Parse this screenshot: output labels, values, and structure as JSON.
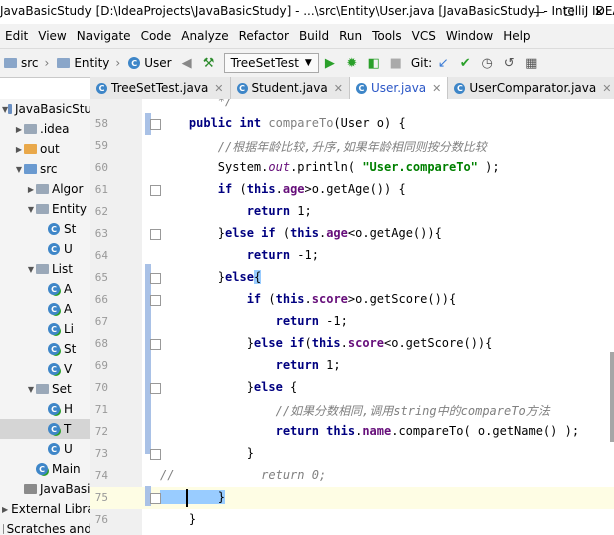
{
  "titlebar": {
    "title": "JavaBasicStudy [D:\\IdeaProjects\\JavaBasicStudy] - ...\\src\\Entity\\User.java [JavaBasicStudy] - IntelliJ IDEA (..."
  },
  "menu": [
    "Edit",
    "View",
    "Navigate",
    "Code",
    "Analyze",
    "Refactor",
    "Build",
    "Run",
    "Tools",
    "VCS",
    "Window",
    "Help"
  ],
  "nav": {
    "crumbs": [
      "src",
      "Entity",
      "User"
    ],
    "run_config": "TreeSetTest",
    "git_label": "Git:"
  },
  "tabs": [
    {
      "label": "TreeSetTest.java",
      "active": false
    },
    {
      "label": "Student.java",
      "active": false
    },
    {
      "label": "User.java",
      "active": true
    },
    {
      "label": "UserComparator.java",
      "active": false
    }
  ],
  "project_tree": [
    {
      "label": "JavaBasicStu",
      "indent": 0,
      "arrow": "down",
      "icon": "module"
    },
    {
      "label": ".idea",
      "indent": 1,
      "arrow": "right",
      "icon": "folder"
    },
    {
      "label": "out",
      "indent": 1,
      "arrow": "right",
      "icon": "folder-orange"
    },
    {
      "label": "src",
      "indent": 1,
      "arrow": "down",
      "icon": "folder-blue"
    },
    {
      "label": "Algor",
      "indent": 2,
      "arrow": "right",
      "icon": "package"
    },
    {
      "label": "Entity",
      "indent": 2,
      "arrow": "down",
      "icon": "package"
    },
    {
      "label": "St",
      "indent": 3,
      "arrow": "",
      "icon": "class"
    },
    {
      "label": "U",
      "indent": 3,
      "arrow": "",
      "icon": "class"
    },
    {
      "label": "List",
      "indent": 2,
      "arrow": "down",
      "icon": "package"
    },
    {
      "label": "A",
      "indent": 3,
      "arrow": "",
      "icon": "class-run"
    },
    {
      "label": "A",
      "indent": 3,
      "arrow": "",
      "icon": "class-run"
    },
    {
      "label": "Li",
      "indent": 3,
      "arrow": "",
      "icon": "class-run"
    },
    {
      "label": "St",
      "indent": 3,
      "arrow": "",
      "icon": "class-run"
    },
    {
      "label": "V",
      "indent": 3,
      "arrow": "",
      "icon": "class-run"
    },
    {
      "label": "Set",
      "indent": 2,
      "arrow": "down",
      "icon": "package"
    },
    {
      "label": "H",
      "indent": 3,
      "arrow": "",
      "icon": "class-run"
    },
    {
      "label": "T",
      "indent": 3,
      "arrow": "",
      "icon": "class-run",
      "selected": true
    },
    {
      "label": "U",
      "indent": 3,
      "arrow": "",
      "icon": "class"
    },
    {
      "label": "Main",
      "indent": 2,
      "arrow": "",
      "icon": "class-run"
    },
    {
      "label": "JavaBasic",
      "indent": 1,
      "arrow": "",
      "icon": "file"
    },
    {
      "label": "External Libra",
      "indent": 0,
      "arrow": "right",
      "icon": "library"
    },
    {
      "label": "Scratches and",
      "indent": 0,
      "arrow": "",
      "icon": "scratch"
    }
  ],
  "code_lines": [
    {
      "n": "",
      "parts": [
        {
          "t": "        */",
          "c": "cmt"
        }
      ]
    },
    {
      "n": "58",
      "parts": [
        {
          "t": "    ",
          "c": ""
        },
        {
          "t": "public int ",
          "c": "kw"
        },
        {
          "t": "compareTo",
          "c": "mth"
        },
        {
          "t": "(User o) {",
          "c": ""
        }
      ]
    },
    {
      "n": "59",
      "parts": [
        {
          "t": "        //根据年龄比较,升序,如果年龄相同则按分数比较",
          "c": "cmt"
        }
      ]
    },
    {
      "n": "60",
      "parts": [
        {
          "t": "        System.",
          "c": ""
        },
        {
          "t": "out",
          "c": "stat"
        },
        {
          "t": ".println( ",
          "c": ""
        },
        {
          "t": "\"User.compareTo\"",
          "c": "str"
        },
        {
          "t": " );",
          "c": ""
        }
      ]
    },
    {
      "n": "61",
      "parts": [
        {
          "t": "        ",
          "c": ""
        },
        {
          "t": "if ",
          "c": "kw"
        },
        {
          "t": "(",
          "c": ""
        },
        {
          "t": "this",
          "c": "kw"
        },
        {
          "t": ".",
          "c": ""
        },
        {
          "t": "age",
          "c": "fld"
        },
        {
          "t": ">o.getAge()) {",
          "c": ""
        }
      ]
    },
    {
      "n": "62",
      "parts": [
        {
          "t": "            ",
          "c": ""
        },
        {
          "t": "return ",
          "c": "kw"
        },
        {
          "t": "1;",
          "c": ""
        }
      ]
    },
    {
      "n": "63",
      "parts": [
        {
          "t": "        }",
          "c": ""
        },
        {
          "t": "else if ",
          "c": "kw"
        },
        {
          "t": "(",
          "c": ""
        },
        {
          "t": "this",
          "c": "kw"
        },
        {
          "t": ".",
          "c": ""
        },
        {
          "t": "age",
          "c": "fld"
        },
        {
          "t": "<o.getAge()){",
          "c": ""
        }
      ]
    },
    {
      "n": "64",
      "parts": [
        {
          "t": "            ",
          "c": ""
        },
        {
          "t": "return ",
          "c": "kw"
        },
        {
          "t": "-1;",
          "c": ""
        }
      ]
    },
    {
      "n": "65",
      "parts": [
        {
          "t": "        }",
          "c": ""
        },
        {
          "t": "else",
          "c": "kw"
        },
        {
          "t": "{",
          "c": "bracehl"
        }
      ]
    },
    {
      "n": "66",
      "parts": [
        {
          "t": "            ",
          "c": ""
        },
        {
          "t": "if ",
          "c": "kw"
        },
        {
          "t": "(",
          "c": ""
        },
        {
          "t": "this",
          "c": "kw"
        },
        {
          "t": ".",
          "c": ""
        },
        {
          "t": "score",
          "c": "fld"
        },
        {
          "t": ">o.getScore()){",
          "c": ""
        }
      ]
    },
    {
      "n": "67",
      "parts": [
        {
          "t": "                ",
          "c": ""
        },
        {
          "t": "return ",
          "c": "kw"
        },
        {
          "t": "-1;",
          "c": ""
        }
      ]
    },
    {
      "n": "68",
      "parts": [
        {
          "t": "            }",
          "c": ""
        },
        {
          "t": "else if",
          "c": "kw"
        },
        {
          "t": "(",
          "c": ""
        },
        {
          "t": "this",
          "c": "kw"
        },
        {
          "t": ".",
          "c": ""
        },
        {
          "t": "score",
          "c": "fld"
        },
        {
          "t": "<o.getScore()){",
          "c": ""
        }
      ]
    },
    {
      "n": "69",
      "parts": [
        {
          "t": "                ",
          "c": ""
        },
        {
          "t": "return ",
          "c": "kw"
        },
        {
          "t": "1;",
          "c": ""
        }
      ]
    },
    {
      "n": "70",
      "parts": [
        {
          "t": "            }",
          "c": ""
        },
        {
          "t": "else ",
          "c": "kw"
        },
        {
          "t": "{",
          "c": ""
        }
      ]
    },
    {
      "n": "71",
      "parts": [
        {
          "t": "                //如果分数相同,调用",
          "c": "cmt"
        },
        {
          "t": "string",
          "c": "cmt-it"
        },
        {
          "t": "中的",
          "c": "cmt"
        },
        {
          "t": "compareTo",
          "c": "cmt-it"
        },
        {
          "t": "方法",
          "c": "cmt"
        }
      ]
    },
    {
      "n": "72",
      "parts": [
        {
          "t": "                ",
          "c": ""
        },
        {
          "t": "return this",
          "c": "kw"
        },
        {
          "t": ".",
          "c": ""
        },
        {
          "t": "name",
          "c": "fld"
        },
        {
          "t": ".compareTo( o.getName() );",
          "c": ""
        }
      ]
    },
    {
      "n": "73",
      "parts": [
        {
          "t": "            }",
          "c": ""
        }
      ]
    },
    {
      "n": "74",
      "parts": [
        {
          "t": "//",
          "c": "cmt"
        },
        {
          "t": "            return 0;",
          "c": "cmt-it"
        }
      ]
    },
    {
      "n": "75",
      "parts": [
        {
          "t": "        }",
          "c": "bracehl"
        }
      ],
      "caret": true
    },
    {
      "n": "76",
      "parts": [
        {
          "t": "    }",
          "c": ""
        }
      ]
    }
  ]
}
